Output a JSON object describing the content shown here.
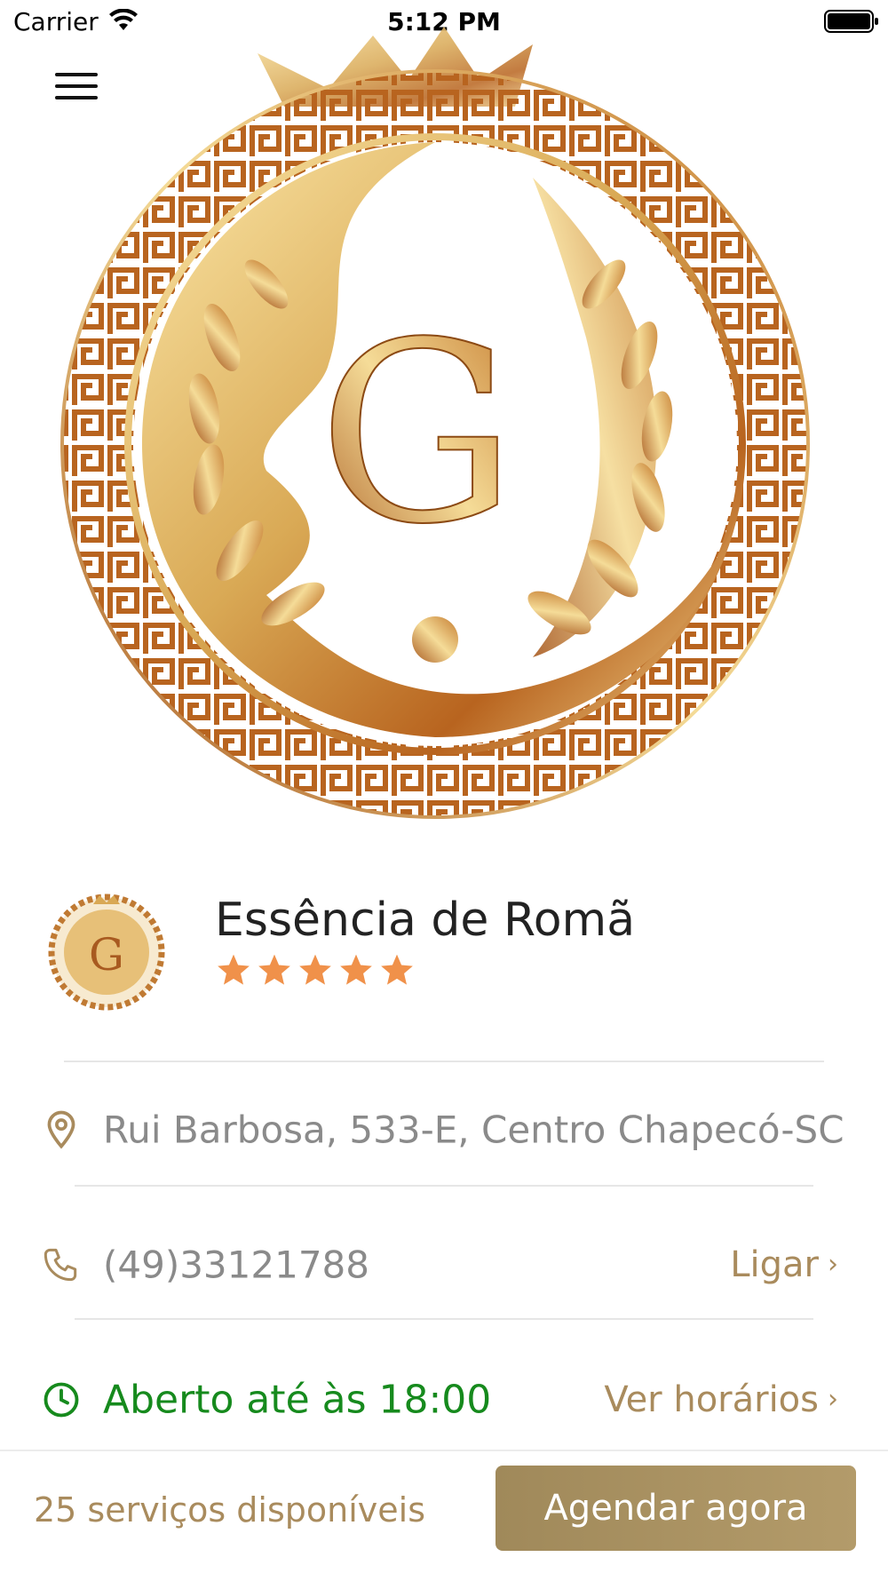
{
  "status_bar": {
    "carrier": "Carrier",
    "time": "5:12 PM"
  },
  "business": {
    "name": "Essência de Romã",
    "rating": 5,
    "address": "Rui Barbosa, 533-E, Centro Chapecó-SC",
    "phone": "(49)33121788",
    "call_label": "Ligar",
    "hours_status": "Aberto até às 18:00",
    "hours_link": "Ver horários"
  },
  "footer": {
    "services_count": "25 serviços disponíveis",
    "book_button": "Agendar agora"
  },
  "colors": {
    "accent": "#a98b5d",
    "star": "#f0914a",
    "open_green": "#168a1d",
    "gold_light": "#f3d58c",
    "gold_dark": "#b8641f"
  },
  "icons": {
    "menu": "hamburger-menu-icon",
    "address": "map-pin-icon",
    "phone": "phone-icon",
    "hours": "clock-icon"
  }
}
